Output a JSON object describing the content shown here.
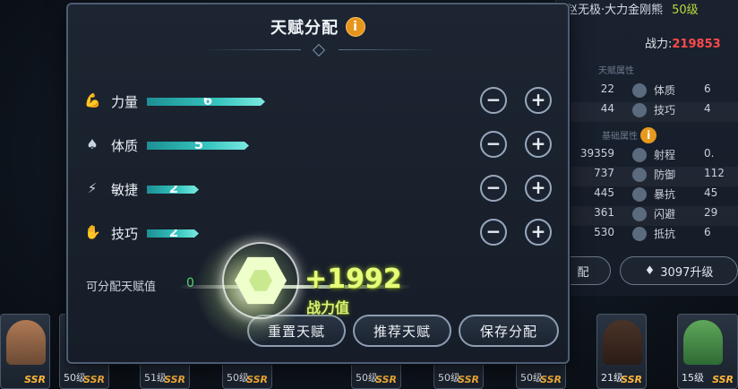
{
  "background": {
    "hero_title": "赵无极·大力金刚熊",
    "hero_level": "50级",
    "power_label": "战力:",
    "power_value": "219853",
    "section_talent": "天赋属性",
    "section_base": "基础属性",
    "talent_rows": [
      {
        "n1": "22",
        "label": "体质",
        "n2": "6"
      },
      {
        "n1": "44",
        "label": "技巧",
        "n2": "4"
      }
    ],
    "base_rows": [
      {
        "n1": "39359",
        "label": "射程",
        "n2": "0."
      },
      {
        "n1": "737",
        "label": "防御",
        "n2": "112"
      },
      {
        "n1": "445",
        "label": "暴抗",
        "n2": "45"
      },
      {
        "n1": "361",
        "label": "闪避",
        "n2": "29"
      },
      {
        "n1": "530",
        "label": "抵抗",
        "n2": "6"
      }
    ],
    "left_btn_label": "配",
    "upgrade_label": "3097升级"
  },
  "dialog": {
    "title": "天赋分配",
    "info_icon": "i",
    "stats": [
      {
        "label": "力量",
        "value": "6",
        "icon": "arm-icon",
        "glyph": "💪"
      },
      {
        "label": "体质",
        "value": "5",
        "icon": "body-icon",
        "glyph": "♠"
      },
      {
        "label": "敏捷",
        "value": "2",
        "icon": "foot-icon",
        "glyph": "⚡"
      },
      {
        "label": "技巧",
        "value": "2",
        "icon": "hand-icon",
        "glyph": "✋"
      }
    ],
    "minus": "−",
    "plus": "+",
    "available_label": "可分配天赋值",
    "available_value": "0",
    "reset_label": "重置天赋",
    "recommend_label": "推荐天赋",
    "save_label": "保存分配"
  },
  "effect": {
    "gain": "+1992",
    "gain_label": "战力值"
  },
  "cards": [
    {
      "level": "",
      "ssr": "SSR"
    },
    {
      "level": "50级",
      "ssr": "SSR"
    },
    {
      "level": "51级",
      "ssr": "SSR"
    },
    {
      "level": "50级",
      "ssr": "SSR"
    },
    {
      "level": "50级",
      "ssr": "SSR"
    },
    {
      "level": "50级",
      "ssr": "SSR"
    },
    {
      "level": "50级",
      "ssr": "SSR"
    },
    {
      "level": "21级",
      "ssr": "SSR"
    },
    {
      "level": "15级",
      "ssr": "SSR"
    }
  ],
  "colors": {
    "accent_bar": "#36c6c0",
    "power_red": "#ff4a4a",
    "gain_green": "#e6ff7a",
    "info_orange": "#e8951c"
  }
}
